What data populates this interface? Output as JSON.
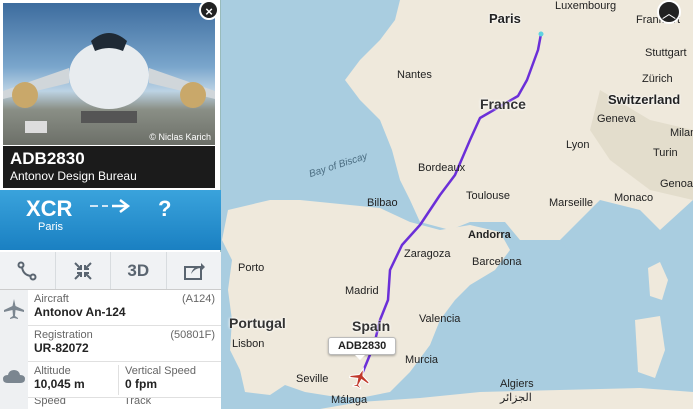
{
  "flight": {
    "callsign": "ADB2830",
    "operator": "Antonov Design Bureau",
    "photo_credit": "© Niclas Karich",
    "origin_code": "XCR",
    "origin_city": "Paris",
    "destination_code": "?"
  },
  "toolbar": {
    "threed_label": "3D"
  },
  "details": {
    "aircraft_label": "Aircraft",
    "aircraft_value": "Antonov An-124",
    "aircraft_code": "(A124)",
    "registration_label": "Registration",
    "registration_value": "UR-82072",
    "registration_code": "(50801F)",
    "altitude_label": "Altitude",
    "altitude_value": "10,045 m",
    "vspeed_label": "Vertical Speed",
    "vspeed_value": "0 fpm",
    "speed_label": "Speed",
    "track_label": "Track"
  },
  "map": {
    "marker_label": "ADB2830",
    "cities": [
      "Paris",
      "Nantes",
      "Luxembourg",
      "Frankfurt",
      "Stuttgart",
      "Zürich",
      "Lyon",
      "Geneva",
      "Turin",
      "Milan",
      "Bordeaux",
      "Toulouse",
      "Marseille",
      "Monaco",
      "Genoa",
      "Bilbao",
      "Andorra",
      "Zaragoza",
      "Barcelona",
      "Porto",
      "Madrid",
      "Valencia",
      "Lisbon",
      "Seville",
      "Murcia",
      "Málaga",
      "Algiers",
      "الجزائر"
    ],
    "countries": [
      "France",
      "Switzerland",
      "Spain",
      "Portugal"
    ],
    "sea": "Bay of Biscay"
  },
  "colors": {
    "route_line": "#6b2fd8",
    "panel_blue": "#2a92d0",
    "header_dark": "#1b1b1b"
  }
}
